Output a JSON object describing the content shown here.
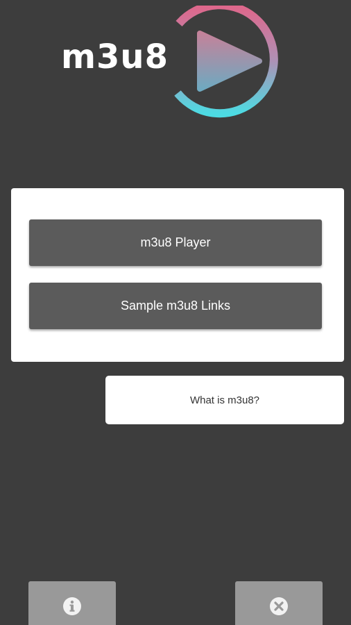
{
  "logo": {
    "text": "m3u8",
    "ring_gradient": [
      "#e0668a",
      "#4ddbe3"
    ],
    "triangle_gradient": [
      "#c4829a",
      "#6fa9c0"
    ]
  },
  "menu": {
    "player_label": "m3u8 Player",
    "samples_label": "Sample m3u8 Links"
  },
  "what_label": "What is m3u8?",
  "bottom": {
    "info_icon": "info-icon",
    "close_icon": "close-icon"
  },
  "colors": {
    "background": "#3d3d3d",
    "button": "#5b5b5b",
    "bottom_button": "#999999"
  }
}
